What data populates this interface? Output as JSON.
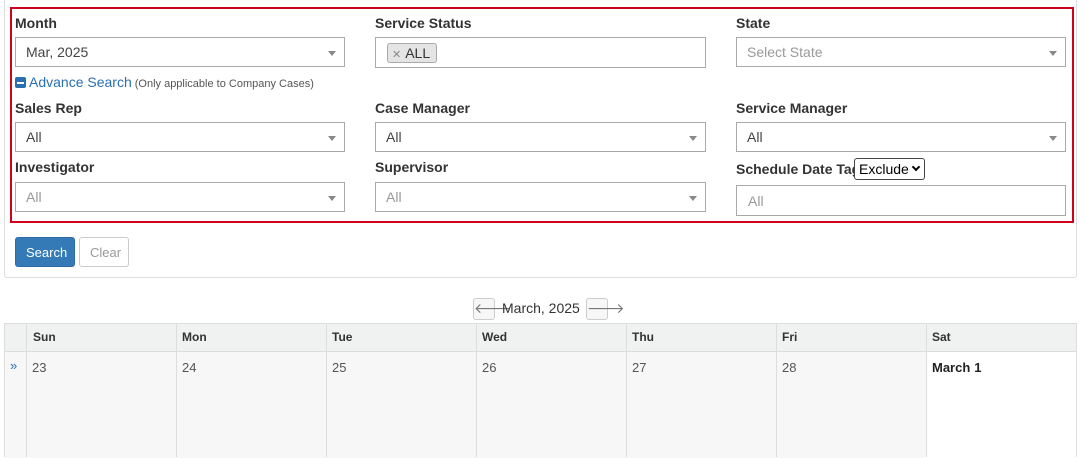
{
  "filters": {
    "month": {
      "label": "Month",
      "value": "Mar, 2025"
    },
    "service_status": {
      "label": "Service Status",
      "tag": "ALL"
    },
    "state": {
      "label": "State",
      "placeholder": "Select State"
    },
    "advance_search": {
      "link": "Advance Search",
      "note": "(Only applicable to Company Cases)"
    },
    "sales_rep": {
      "label": "Sales Rep",
      "value": "All"
    },
    "case_manager": {
      "label": "Case Manager",
      "value": "All"
    },
    "service_manager": {
      "label": "Service Manager",
      "value": "All"
    },
    "investigator": {
      "label": "Investigator",
      "value": "All"
    },
    "supervisor": {
      "label": "Supervisor",
      "value": "All"
    },
    "schedule_date_tag": {
      "label": "Schedule Date Tag",
      "mode": "Exclude",
      "placeholder": "All"
    }
  },
  "buttons": {
    "search": "Search",
    "clear": "Clear"
  },
  "calendar": {
    "title": "March, 2025",
    "headers": [
      "Sun",
      "Mon",
      "Tue",
      "Wed",
      "Thu",
      "Fri",
      "Sat"
    ],
    "row_arrow": "»",
    "days": [
      "23",
      "24",
      "25",
      "26",
      "27",
      "28",
      "1"
    ],
    "current_month_label": "March"
  },
  "icons": {
    "prev": "arrow-left-icon",
    "next": "arrow-right-icon",
    "collapse": "minus-square-icon"
  },
  "colors": {
    "accent": "#337ab7",
    "highlight_border": "#d0021b"
  }
}
